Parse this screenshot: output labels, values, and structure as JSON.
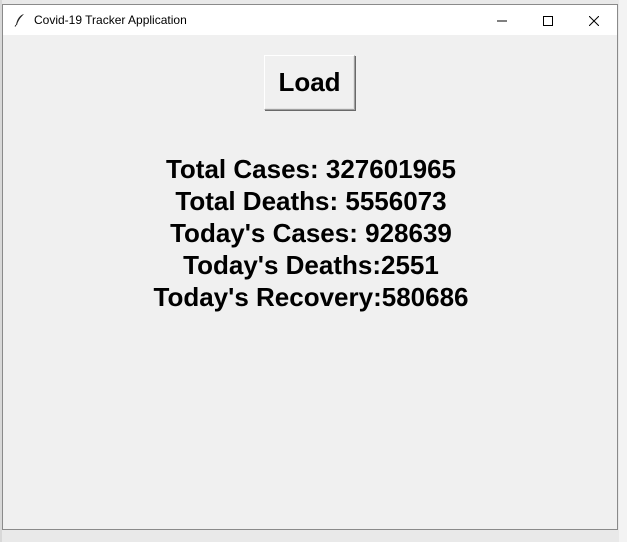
{
  "window": {
    "title": "Covid-19 Tracker Application",
    "icon": "feather-icon"
  },
  "titlebar_controls": {
    "minimize_icon": "minimize-icon",
    "maximize_icon": "maximize-icon",
    "close_icon": "close-icon"
  },
  "load_button": {
    "label": "Load"
  },
  "stats": {
    "total_cases": "Total Cases: 327601965",
    "total_deaths": "Total Deaths: 5556073",
    "todays_cases": "Today's Cases: 928639",
    "todays_deaths": "Today's Deaths:2551",
    "todays_recovery": "Today's Recovery:580686"
  }
}
